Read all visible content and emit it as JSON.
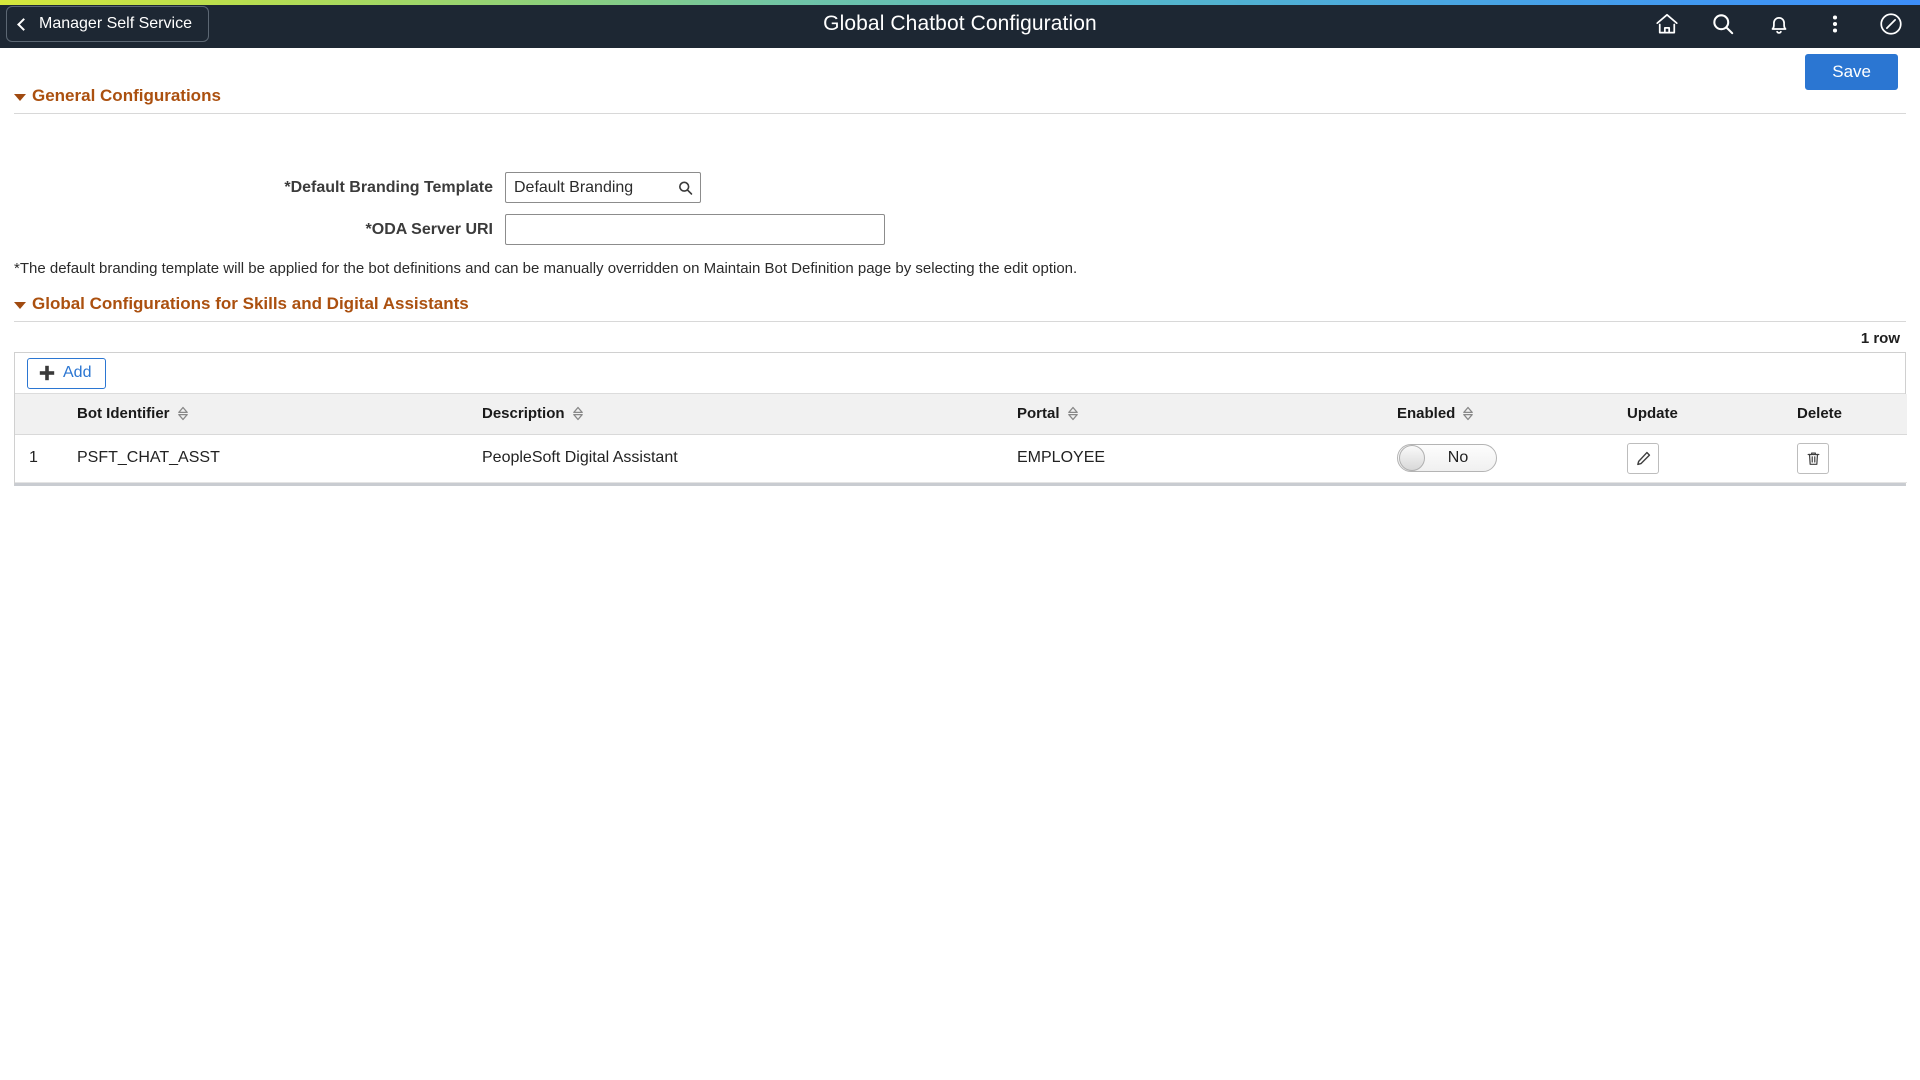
{
  "header": {
    "back_label": "Manager Self Service",
    "title": "Global Chatbot Configuration",
    "icons": [
      {
        "name": "home-icon",
        "label": "Home"
      },
      {
        "name": "search-icon",
        "label": "Search"
      },
      {
        "name": "notifications-bell-icon",
        "label": "Notifications"
      },
      {
        "name": "actions-kebab-icon",
        "label": "Actions"
      },
      {
        "name": "navbar-compass-icon",
        "label": "NavBar"
      }
    ],
    "colors": {
      "bar": "#1d2733",
      "title_text": "#ffffff"
    }
  },
  "toolbar": {
    "save_label": "Save",
    "save_color": "#2b76d2"
  },
  "sections": {
    "general": {
      "title": "General Configurations",
      "expanded": true,
      "fields": {
        "branding": {
          "label": "*Default Branding Template",
          "value": "Default Branding",
          "placeholder": "",
          "lookup_icon": "search-icon"
        },
        "oda_uri": {
          "label": "*ODA Server URI",
          "value": "",
          "placeholder": ""
        }
      },
      "note": "*The default branding template will be applied for the bot definitions and can be manually overridden on Maintain Bot Definition page by selecting the edit option."
    },
    "global": {
      "title": "Global Configurations for Skills and Digital Assistants",
      "expanded": true,
      "row_count": "1 row",
      "add_label": "Add"
    }
  },
  "grid": {
    "columns": [
      {
        "key": "num",
        "label": "",
        "sortable": false
      },
      {
        "key": "bot",
        "label": "Bot Identifier",
        "sortable": true
      },
      {
        "key": "desc",
        "label": "Description",
        "sortable": true
      },
      {
        "key": "portal",
        "label": "Portal",
        "sortable": true
      },
      {
        "key": "enab",
        "label": "Enabled",
        "sortable": true
      },
      {
        "key": "upd",
        "label": "Update",
        "sortable": false
      },
      {
        "key": "del",
        "label": "Delete",
        "sortable": false
      }
    ],
    "rows": [
      {
        "num": "1",
        "bot": "PSFT_CHAT_ASST",
        "desc": "PeopleSoft Digital Assistant",
        "portal": "EMPLOYEE",
        "enabled_label": "No",
        "enabled_state": "off",
        "update_icon": "edit-pencil-icon",
        "delete_icon": "trash-can-icon"
      }
    ]
  },
  "theme": {
    "section_header_text": "#ab500f",
    "accent_blue": "#2b76d2",
    "grid_header_bg": "#f1f1f1",
    "page_bg": "#ffffff"
  }
}
